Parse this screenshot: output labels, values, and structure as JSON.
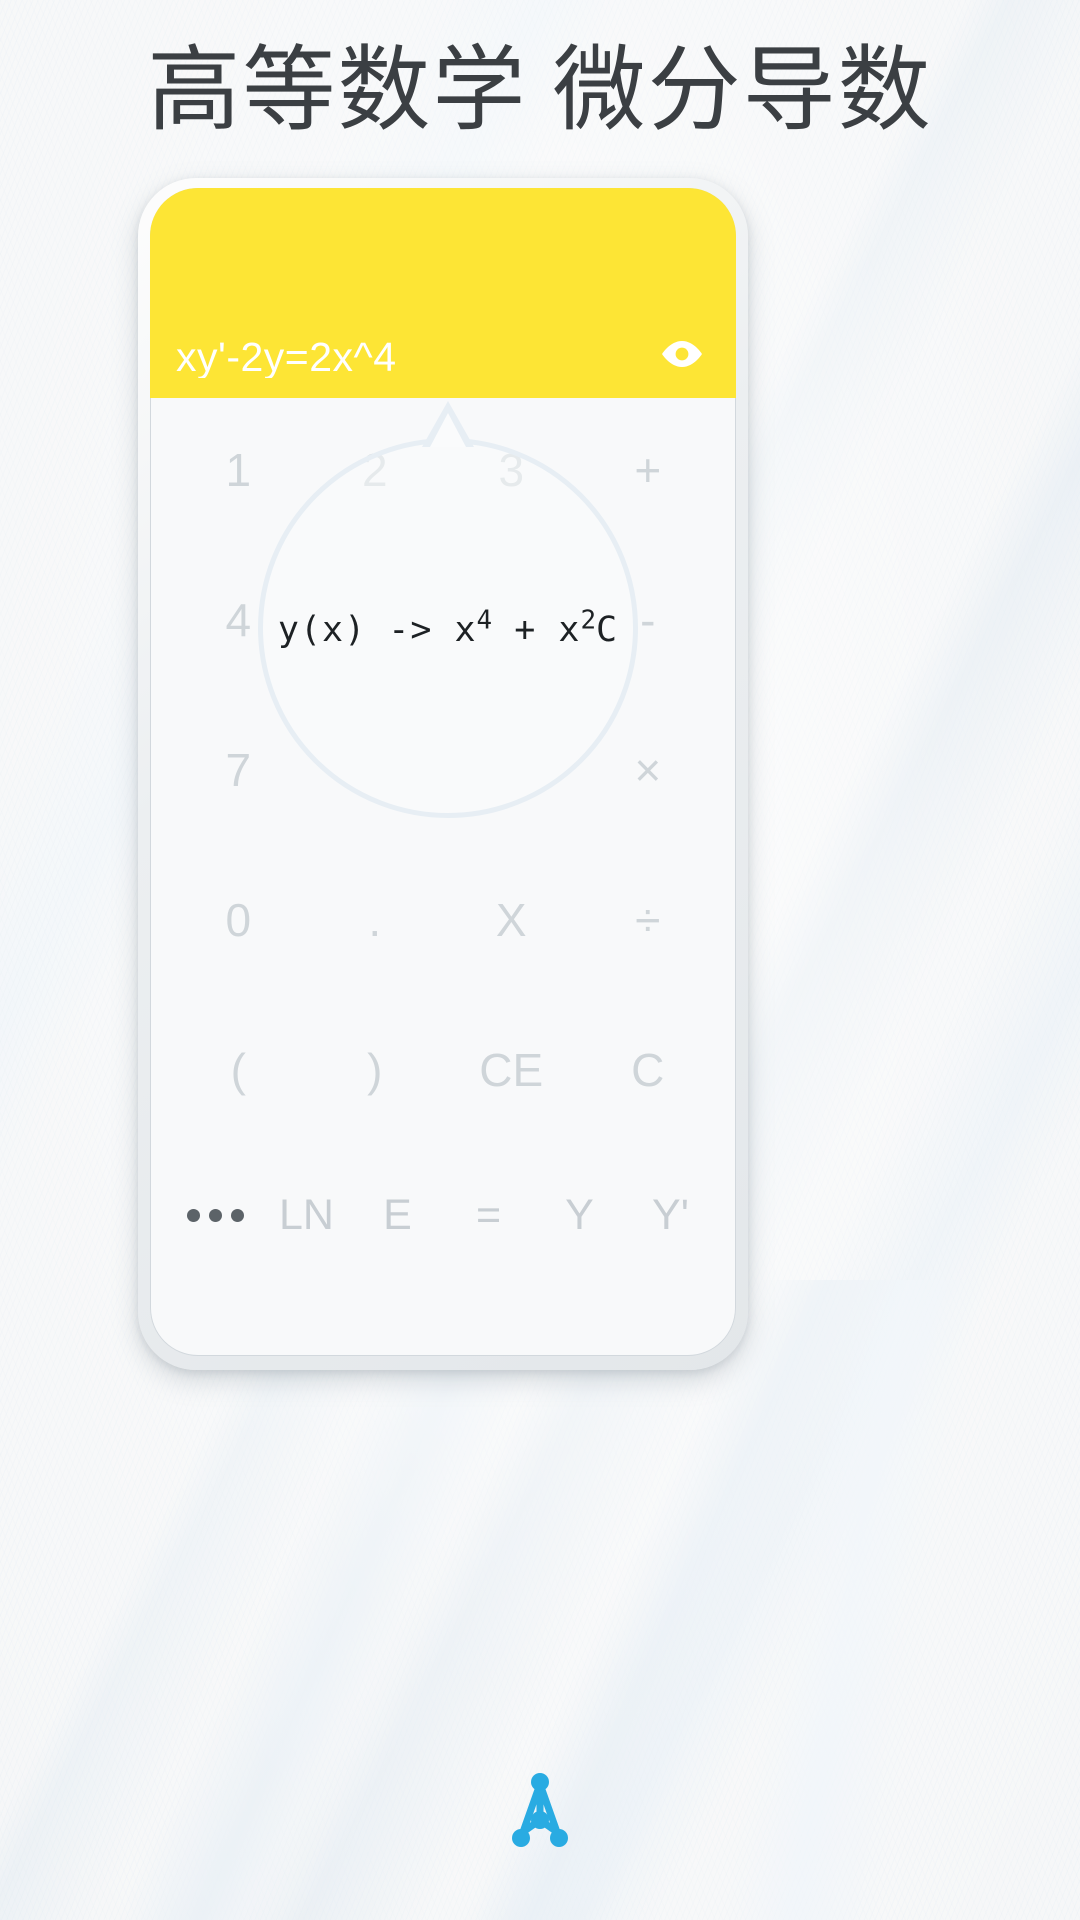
{
  "page": {
    "title": "高等数学 微分导数",
    "background_color": "#f6f7f8",
    "title_color": "#3b3f43"
  },
  "app": {
    "accent_color": "#fde535",
    "screen_color": "#f8f9fa",
    "key_color": "#cfd5d9"
  },
  "calculator": {
    "input": {
      "value": "xy'-2y=2x^4",
      "placeholder": "",
      "text_color": "#ffffff"
    },
    "toggle_visibility": {
      "icon": "eye-icon",
      "color": "#ffffff"
    },
    "result": {
      "prefix": "y(x) -> x",
      "exp1": "4",
      "mid": " + x",
      "exp2": "2",
      "suffix": "C",
      "full_text": "y(x) -> x^4 + x^2 C",
      "bubble_border_color": "#e7eef4"
    },
    "keypad": {
      "rows": [
        {
          "keys": [
            {
              "label": "1",
              "name": "key-1",
              "style": "light"
            },
            {
              "label": "2",
              "name": "key-2",
              "style": "light"
            },
            {
              "label": "3",
              "name": "key-3",
              "style": "light"
            },
            {
              "label": "+",
              "name": "key-plus",
              "style": "light"
            }
          ]
        },
        {
          "keys": [
            {
              "label": "4",
              "name": "key-4",
              "style": "light"
            },
            {
              "label": "",
              "name": "key-blank-1",
              "style": "light"
            },
            {
              "label": "",
              "name": "key-blank-2",
              "style": "light"
            },
            {
              "label": "-",
              "name": "key-minus",
              "style": "light"
            }
          ]
        },
        {
          "keys": [
            {
              "label": "7",
              "name": "key-7",
              "style": "light"
            },
            {
              "label": "",
              "name": "key-blank-3",
              "style": "light"
            },
            {
              "label": "",
              "name": "key-blank-4",
              "style": "light"
            },
            {
              "label": "×",
              "name": "key-multiply",
              "style": "light"
            }
          ]
        },
        {
          "keys": [
            {
              "label": "0",
              "name": "key-0",
              "style": "light"
            },
            {
              "label": ".",
              "name": "key-decimal",
              "style": "light"
            },
            {
              "label": "X",
              "name": "key-variable-x",
              "style": "light"
            },
            {
              "label": "÷",
              "name": "key-divide",
              "style": "light"
            }
          ]
        },
        {
          "keys": [
            {
              "label": "(",
              "name": "key-paren-open",
              "style": "light"
            },
            {
              "label": ")",
              "name": "key-paren-close",
              "style": "light"
            },
            {
              "label": "CE",
              "name": "key-clear-entry",
              "style": "light"
            },
            {
              "label": "C",
              "name": "key-clear",
              "style": "light"
            }
          ]
        }
      ],
      "function_row": {
        "more_icon": "ellipsis-icon",
        "keys": [
          {
            "label": "LN",
            "name": "key-natural-log"
          },
          {
            "label": "E",
            "name": "key-euler-e"
          },
          {
            "label": "=",
            "name": "key-equals"
          },
          {
            "label": "Y",
            "name": "key-variable-y"
          },
          {
            "label": "Y'",
            "name": "key-variable-y-prime"
          }
        ]
      }
    }
  },
  "brand": {
    "logo_name": "tree-graph-logo",
    "color": "#29abe2"
  }
}
